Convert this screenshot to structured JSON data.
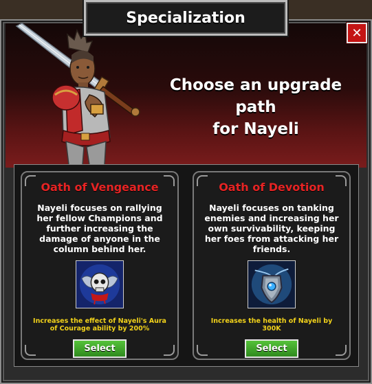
{
  "dialog": {
    "title": "Specialization",
    "close_label": "✕",
    "prompt_line1": "Choose an upgrade path",
    "prompt_line2": "for Nayeli"
  },
  "options": [
    {
      "title": "Oath of Vengeance",
      "description": "Nayeli focuses on rallying her fellow Champions and further increasing the damage of anyone in the column behind her.",
      "icon": "winged-skull-icon",
      "effect": "Increases the effect of Nayeli's Aura of Courage ability by 200%",
      "button_label": "Select"
    },
    {
      "title": "Oath of Devotion",
      "description": "Nayeli focuses on tanking enemies and increasing her own survivability, keeping her foes from attacking her friends.",
      "icon": "shield-amulet-icon",
      "effect": "Increases the health of Nayeli by 300K",
      "button_label": "Select"
    }
  ],
  "colors": {
    "option_title": "#e62424",
    "effect_text": "#f2d21a",
    "select_button": "#3fa02a",
    "close_button": "#c41414"
  }
}
